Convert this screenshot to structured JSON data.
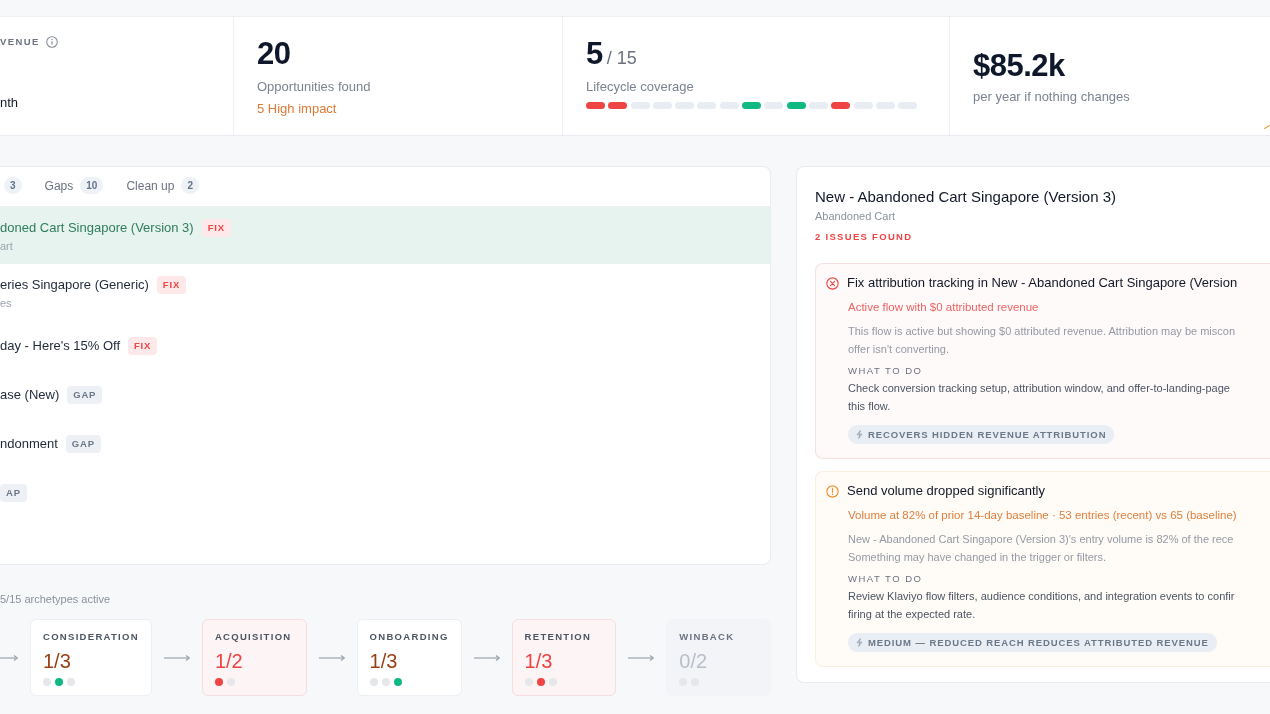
{
  "summary": {
    "revenue": {
      "label": "VENUE",
      "period": "nth"
    },
    "opportunities": {
      "value": "20",
      "caption": "Opportunities found",
      "highlight": "5 High impact"
    },
    "coverage": {
      "value": "5",
      "total": "/ 15",
      "caption": "Lifecycle coverage",
      "segments": [
        {
          "color": "#ef4444"
        },
        {
          "color": "#ef4444"
        },
        {
          "color": "#e8edf3"
        },
        {
          "color": "#e8edf3"
        },
        {
          "color": "#e8edf3"
        },
        {
          "color": "#e8edf3"
        },
        {
          "color": "#e8edf3"
        },
        {
          "color": "#10b981"
        },
        {
          "color": "#e8edf3"
        },
        {
          "color": "#10b981"
        },
        {
          "color": "#e8edf3"
        },
        {
          "color": "#ef4444"
        },
        {
          "color": "#e8edf3"
        },
        {
          "color": "#e8edf3"
        },
        {
          "color": "#e8edf3"
        }
      ]
    },
    "loss": {
      "value": "$85.2k",
      "caption": "per year if nothing changes"
    }
  },
  "flow_list": {
    "tabs": [
      {
        "count": "3",
        "selected": false
      },
      {
        "label": "Gaps",
        "count": "10",
        "selected": false
      },
      {
        "label": "Clean up",
        "count": "2",
        "selected": false
      }
    ],
    "rows": [
      {
        "title": "doned Cart Singapore (Version 3)",
        "subtitle": "art",
        "badge": {
          "kind": "fix",
          "text": "FIX"
        },
        "selected": true
      },
      {
        "title": "eries Singapore (Generic)",
        "subtitle": "es",
        "badge": {
          "kind": "fix",
          "text": "FIX"
        },
        "selected": false
      },
      {
        "title": "day - Here's 15% Off",
        "badge": {
          "kind": "fix",
          "text": "FIX"
        },
        "selected": false
      },
      {
        "title": "ase (New)",
        "badge": {
          "kind": "gap",
          "text": "GAP"
        },
        "selected": false
      },
      {
        "title": "ndonment",
        "badge": {
          "kind": "gap",
          "text": "GAP"
        },
        "selected": false
      },
      {
        "badge": {
          "kind": "gap",
          "text": "AP"
        },
        "selected": false
      }
    ]
  },
  "lifecycle": {
    "summary": "5/15 archetypes active",
    "stages": [
      {
        "kind": "partial",
        "name": "CONSIDERATION",
        "fraction": "1/3",
        "dots": [
          {
            "color": "#e5e7eb"
          },
          {
            "color": "#10b981"
          },
          {
            "color": "#e5e7eb"
          }
        ]
      },
      {
        "kind": "issue",
        "name": "ACQUISITION",
        "fraction": "1/2",
        "dots": [
          {
            "color": "#ef4444"
          },
          {
            "color": "#e5e7eb"
          }
        ]
      },
      {
        "kind": "partial",
        "name": "ONBOARDING",
        "fraction": "1/3",
        "dots": [
          {
            "color": "#e5e7eb"
          },
          {
            "color": "#e5e7eb"
          },
          {
            "color": "#10b981"
          }
        ]
      },
      {
        "kind": "issue",
        "name": "RETENTION",
        "fraction": "1/3",
        "dots": [
          {
            "color": "#e5e7eb"
          },
          {
            "color": "#ef4444"
          },
          {
            "color": "#e5e7eb"
          }
        ]
      },
      {
        "kind": "empty",
        "name": "WINBACK",
        "fraction": "0/2",
        "dots": [
          {
            "color": "#e5e7eb"
          },
          {
            "color": "#e5e7eb"
          }
        ]
      }
    ]
  },
  "detail": {
    "title": "New - Abandoned Cart Singapore (Version 3)",
    "subtitle": "Abandoned Cart",
    "issue_count": "2 ISSUES FOUND",
    "issues": [
      {
        "kind": "error",
        "title": "Fix attribution tracking in New - Abandoned Cart Singapore (Version",
        "finding": "Active flow with $0 attributed revenue",
        "body_lines": [
          "This flow is active but showing $0 attributed revenue. Attribution may be miscon",
          "offer isn't converting."
        ],
        "action_label": "WHAT TO DO",
        "action_lines": [
          "Check conversion tracking setup, attribution window, and offer-to-landing-page",
          "this flow."
        ],
        "impact": "RECOVERS HIDDEN REVENUE ATTRIBUTION"
      },
      {
        "kind": "warning",
        "title": "Send volume dropped significantly",
        "finding": "Volume at 82% of prior 14-day baseline · 53 entries (recent) vs 65 (baseline)",
        "body_lines": [
          "New - Abandoned Cart Singapore (Version 3)'s entry volume is 82% of the rece",
          "Something may have changed in the trigger or filters."
        ],
        "action_label": "WHAT TO DO",
        "action_lines": [
          "Review Klaviyo flow filters, audience conditions, and integration events to confir",
          "firing at the expected rate."
        ],
        "impact": "MEDIUM — REDUCED REACH REDUCES ATTRIBUTED REVENUE"
      }
    ]
  }
}
